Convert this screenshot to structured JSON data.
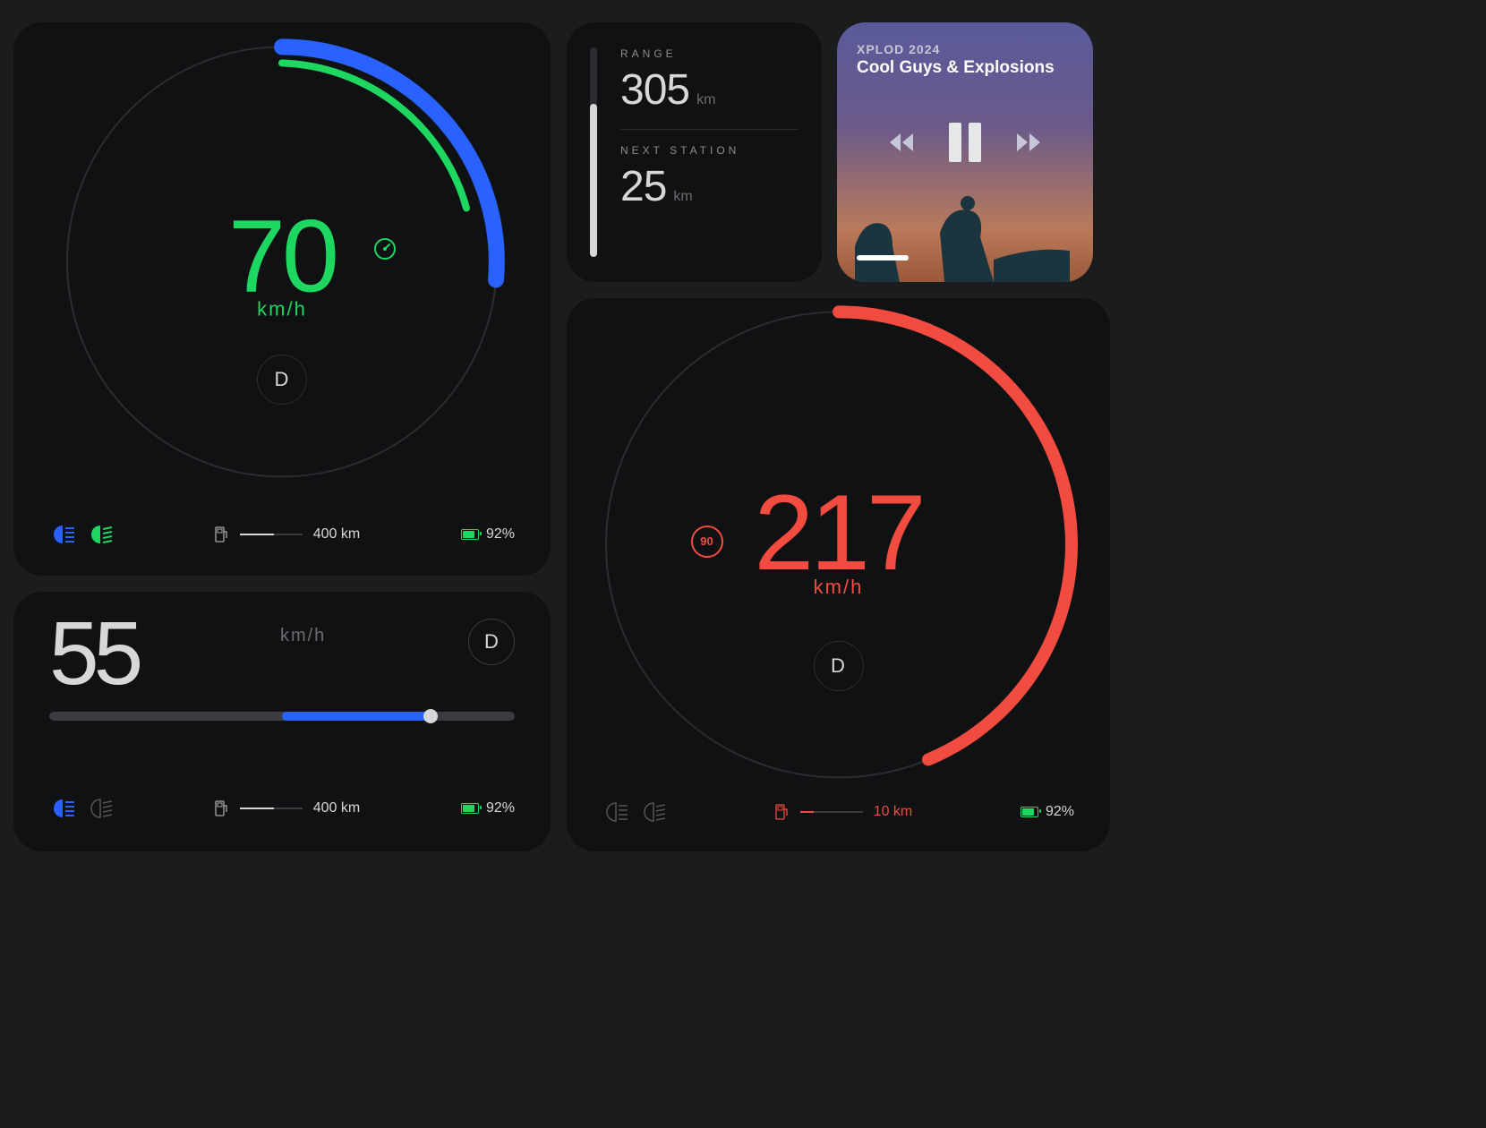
{
  "gauge_green": {
    "speed": "70",
    "unit": "km/h",
    "gear": "D",
    "fuel_range": "400 km",
    "battery_pct": "92%",
    "cruise_on": true,
    "arc_track_deg": 360,
    "arc_outer_blue_pct": 35,
    "arc_inner_green_pct": 27,
    "colors": {
      "speed": "#1ed760",
      "arc_outer": "#2962ff",
      "arc_inner": "#1ed760"
    }
  },
  "gauge_red": {
    "speed": "217",
    "unit": "km/h",
    "gear": "D",
    "speed_limit": "90",
    "fuel_range": "10 km",
    "battery_pct": "92%",
    "arc_red_pct": 60,
    "colors": {
      "speed": "#f24b3f",
      "arc": "#f24b3f"
    }
  },
  "gauge_bar": {
    "speed": "55",
    "unit": "km/h",
    "gear": "D",
    "fuel_range": "400 km",
    "battery_pct": "92%",
    "bar_fill_start_pct": 50,
    "bar_fill_width_pct": 32
  },
  "range_card": {
    "range_label": "RANGE",
    "range_value": "305",
    "range_unit": "km",
    "next_station_label": "NEXT STATION",
    "next_station_value": "25",
    "next_station_unit": "km",
    "vbar_fill_pct": 73
  },
  "media": {
    "artist": "XPLOD 2024",
    "title": "Cool Guys & Explosions",
    "state": "playing",
    "progress_pct": 22
  },
  "icons": {
    "cruise": "cruise-control-icon",
    "high_beam": "high-beam-icon",
    "low_beam": "low-beam-icon",
    "fuel": "fuel-pump-icon",
    "battery": "battery-icon",
    "prev": "previous-track-icon",
    "next": "next-track-icon",
    "pause": "pause-icon"
  }
}
